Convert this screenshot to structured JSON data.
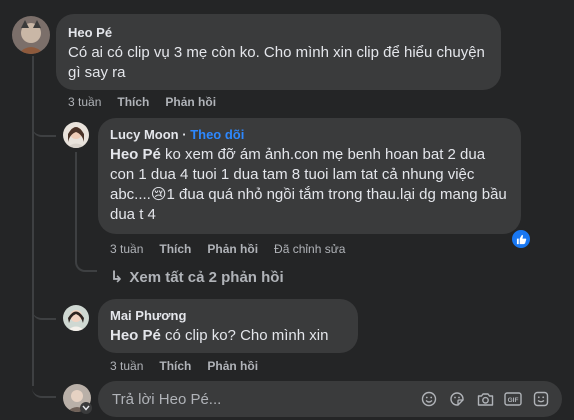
{
  "comments": [
    {
      "author": "Heo Pé",
      "text": "Có ai có clip vụ 3 mẹ còn ko. Cho mình xin clip để hiểu chuyện gì say ra",
      "time": "3 tuần",
      "like_label": "Thích",
      "reply_label": "Phản hồi"
    }
  ],
  "replies": [
    {
      "author": "Lucy Moon",
      "follow_label": "Theo dõi",
      "mention": "Heo Pé",
      "text": " ko xem đỡ ám ảnh.con mẹ benh hoan bat 2 dua con 1 dua 4 tuoi 1 dua tam 8 tuoi lam tat cả nhung việc abc....",
      "emoji": "😢",
      "text_after": "1 đua quá nhỏ ngồi tắm trong thau.lại dg mang bầu dua t 4",
      "time": "3 tuần",
      "like_label": "Thích",
      "reply_label": "Phản hồi",
      "edited_label": "Đã chỉnh sửa"
    },
    {
      "author": "Mai Phương",
      "mention": "Heo Pé",
      "text": " có clip ko? Cho mình xin",
      "time": "3 tuần",
      "like_label": "Thích",
      "reply_label": "Phản hồi"
    }
  ],
  "view_more": {
    "label": "Xem tất cả 2 phản hồi"
  },
  "reply_box": {
    "placeholder": "Trả lời Heo Pé...",
    "tools": [
      "emoji-icon",
      "sticker-icon",
      "camera-icon",
      "gif-icon",
      "gift-sticker-icon"
    ]
  },
  "colors": {
    "background": "#242526",
    "bubble": "#3a3b3c",
    "text": "#e4e6eb",
    "secondary_text": "#b0b3b8",
    "link_blue": "#2d88ff",
    "like_blue": "#1877f2"
  }
}
